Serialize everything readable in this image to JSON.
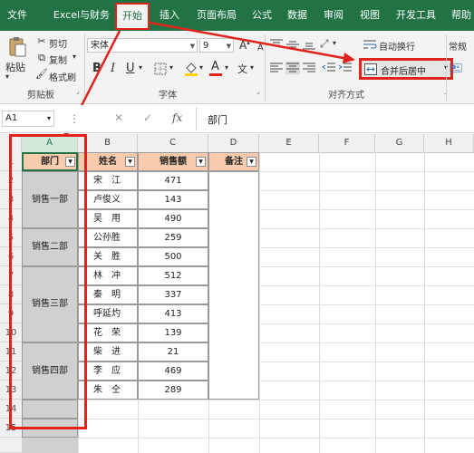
{
  "tabs": [
    "文件",
    "Excel与财务",
    "开始",
    "插入",
    "页面布局",
    "公式",
    "数据",
    "审阅",
    "视图",
    "开发工具",
    "帮助"
  ],
  "active_tab": "开始",
  "clipboard": {
    "paste": "粘贴",
    "cut": "剪切",
    "copy": "复制",
    "format_painter": "格式刷",
    "group": "剪贴板"
  },
  "font": {
    "name": "宋体",
    "size": "9",
    "group": "字体",
    "bold": "B",
    "italic": "I",
    "underline": "U",
    "font_color_glyph": "A",
    "grow": "A",
    "shrink": "A"
  },
  "alignment": {
    "wrap_text": "自动换行",
    "merge_center": "合并后居中",
    "group": "对齐方式"
  },
  "number": {
    "format": "常规"
  },
  "formula_bar": {
    "name_box": "A1",
    "fx": "fx",
    "content": "部门"
  },
  "columns": [
    "A",
    "B",
    "C",
    "D",
    "E",
    "F",
    "G",
    "H"
  ],
  "rows": [
    "1",
    "2",
    "3",
    "4",
    "5",
    "6",
    "7",
    "8",
    "9",
    "10",
    "11",
    "12",
    "13",
    "14",
    "15"
  ],
  "table": {
    "headers": [
      "部门",
      "姓名",
      "销售额",
      "备注"
    ],
    "departments": [
      "销售一部",
      "销售二部",
      "销售三部",
      "销售四部"
    ],
    "names": [
      "宋　江",
      "卢俊义",
      "吴　用",
      "公孙胜",
      "关　胜",
      "林　冲",
      "秦　明",
      "呼延灼",
      "花　荣",
      "柴　进",
      "李　应",
      "朱　仝"
    ],
    "sales": [
      "471",
      "143",
      "490",
      "259",
      "500",
      "512",
      "337",
      "413",
      "139",
      "21",
      "469",
      "289"
    ]
  },
  "colors": {
    "tab_bar": "#217346",
    "header_fill": "#f8cbad",
    "dept_fill": "#d0d0d0",
    "highlight": "#e0241b"
  },
  "icons": [
    "cut-icon",
    "copy-icon",
    "format-painter-icon",
    "paste-icon",
    "merge-center-icon",
    "wrap-text-icon",
    "fill-color-icon",
    "font-color-icon",
    "filter-dropdown-icon"
  ]
}
